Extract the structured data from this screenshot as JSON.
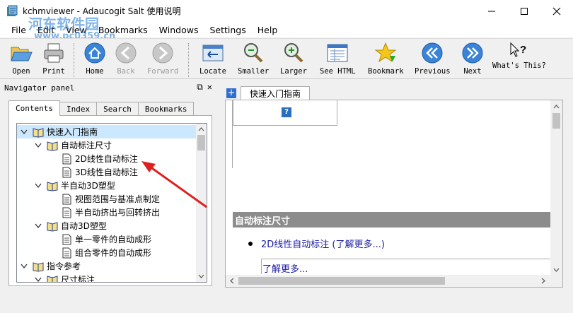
{
  "window": {
    "title": "kchmviewer - Adaucogit Salt 使用说明",
    "watermark_text": "河东软件园",
    "watermark_url": "www.pc0359.cn"
  },
  "menu": [
    "File",
    "Edit",
    "View",
    "Bookmarks",
    "Windows",
    "Settings",
    "Help"
  ],
  "toolbar": {
    "open": "Open",
    "print": "Print",
    "home": "Home",
    "back": "Back",
    "forward": "Forward",
    "locate": "Locate",
    "smaller": "Smaller",
    "larger": "Larger",
    "see_html": "See HTML",
    "bookmark": "Bookmark",
    "previous": "Previous",
    "next": "Next",
    "whats_this": "What's This?"
  },
  "navigator": {
    "title": "Navigator panel",
    "tabs": [
      "Contents",
      "Index",
      "Search",
      "Bookmarks"
    ],
    "tree": [
      "快速入门指南",
      "自动标注尺寸",
      "2D线性自动标注",
      "3D线性自动标注",
      "半自动3D塑型",
      "视图范围与基准点制定",
      "半自动挤出与回转挤出",
      "自动3D塑型",
      "单一零件的自动成形",
      "组合零件的自动成形",
      "指令参考",
      "尺寸标注"
    ]
  },
  "content": {
    "tab_label": "快速入门指南",
    "add_tab": "+",
    "section_title": "自动标注尺寸",
    "bullet_link": "2D线性自动标注 (了解更多...)",
    "more_link": "了解更多..."
  },
  "colors": {
    "accent_blue": "#2c6fd1",
    "section_gray": "#8c8c8c",
    "link_blue": "#1a1aa6",
    "selection": "#cce8ff",
    "arrow_red": "#e02020"
  }
}
